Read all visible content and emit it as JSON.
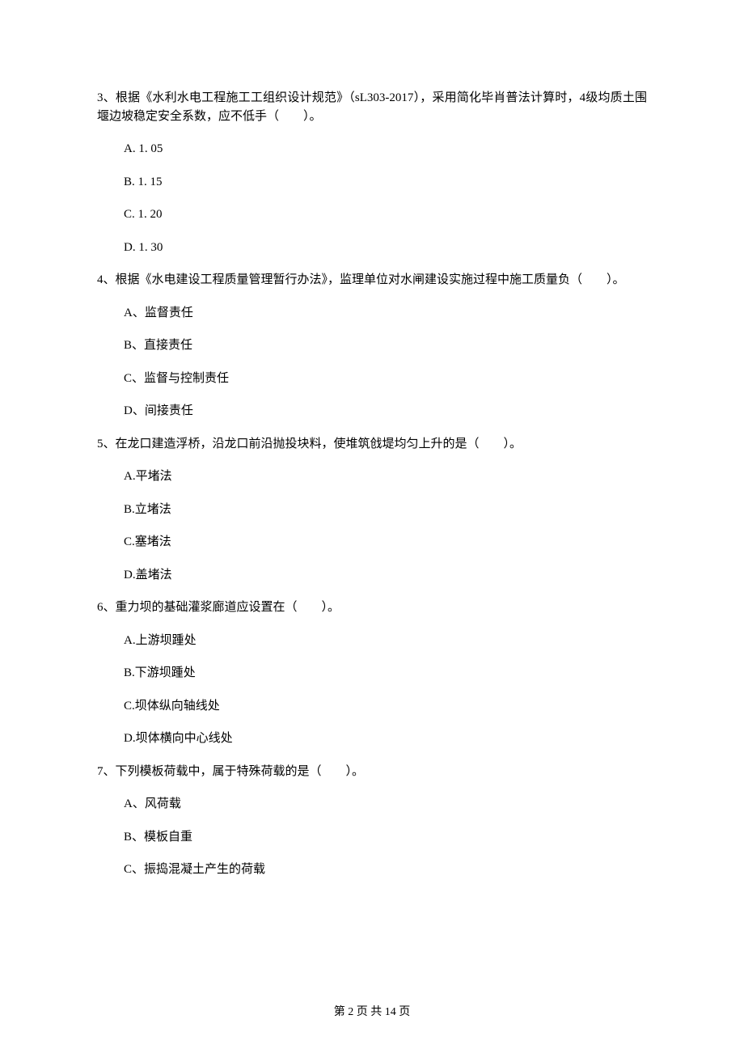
{
  "questions": [
    {
      "stem": "3、根据《水利水电工程施工工组织设计规范》（sL303-2017），采用简化毕肖普法计算时，4级均质土围堰边坡稳定安全系数，应不低手（　　）。",
      "options": [
        "A. 1. 05",
        "B. 1. 15",
        "C. 1. 20",
        "D. 1. 30"
      ]
    },
    {
      "stem": "4、根据《水电建设工程质量管理暂行办法》，监理单位对水闸建设实施过程中施工质量负（　　）。",
      "options": [
        "A、监督责任",
        "B、直接责任",
        "C、监督与控制责任",
        "D、间接责任"
      ]
    },
    {
      "stem": "5、在龙口建造浮桥，沿龙口前沿抛投块料，使堆筑戗堤均匀上升的是（　　）。",
      "options": [
        "A.平堵法",
        "B.立堵法",
        "C.塞堵法",
        "D.盖堵法"
      ]
    },
    {
      "stem": "6、重力坝的基础灌浆廊道应设置在（　　）。",
      "options": [
        "A.上游坝踵处",
        "B.下游坝踵处",
        "C.坝体纵向轴线处",
        "D.坝体横向中心线处"
      ]
    },
    {
      "stem": "7、下列模板荷载中，属于特殊荷载的是（　　）。",
      "options": [
        "A、风荷载",
        "B、模板自重",
        "C、振捣混凝土产生的荷载"
      ]
    }
  ],
  "footer": "第 2 页 共 14 页"
}
